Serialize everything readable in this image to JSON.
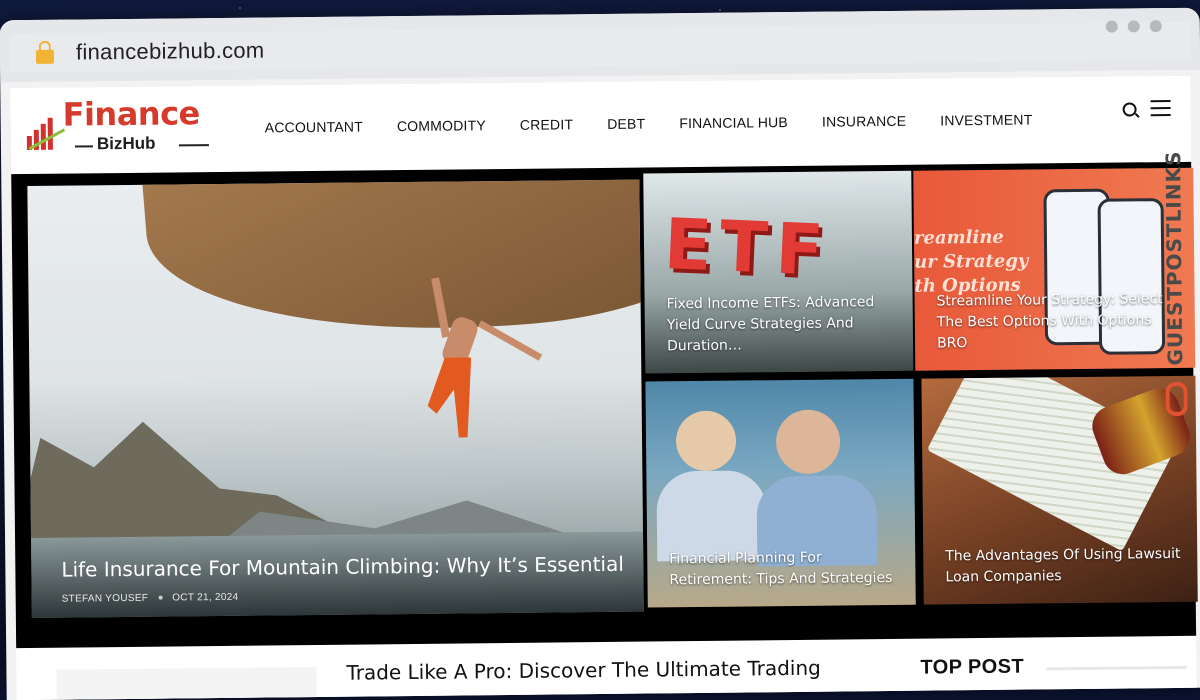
{
  "browser": {
    "url": "financebizhub.com"
  },
  "site": {
    "logo_top": "Finance",
    "logo_bottom": "BizHub"
  },
  "nav": {
    "items": [
      "ACCOUNTANT",
      "COMMODITY",
      "CREDIT",
      "DEBT",
      "FINANCIAL HUB",
      "INSURANCE",
      "INVESTMENT"
    ]
  },
  "featured": {
    "main": {
      "title": "Life Insurance For Mountain Climbing: Why It’s Essential",
      "author": "STEFAN YOUSEF",
      "date": "OCT 21, 2024"
    },
    "cards": [
      {
        "title": "Fixed Income ETFs: Advanced Yield Curve Strategies And Duration…",
        "image_text": "ETF"
      },
      {
        "title": "Streamline Your Strategy: Select The Best Options With Options BRO",
        "image_text": "reamline\nur Strategy\nth Options"
      },
      {
        "title": "Financial Planning For Retirement: Tips And Strategies"
      },
      {
        "title": "The Advantages Of Using Lawsuit Loan Companies"
      }
    ]
  },
  "below": {
    "post_title": "Trade Like A Pro: Discover The Ultimate Trading",
    "section_title": "TOP POST"
  },
  "overlay_brand": "GUESTPOSTLINKS",
  "colors": {
    "brand_red": "#d63a2c",
    "overlay_accent": "#e0532e"
  }
}
